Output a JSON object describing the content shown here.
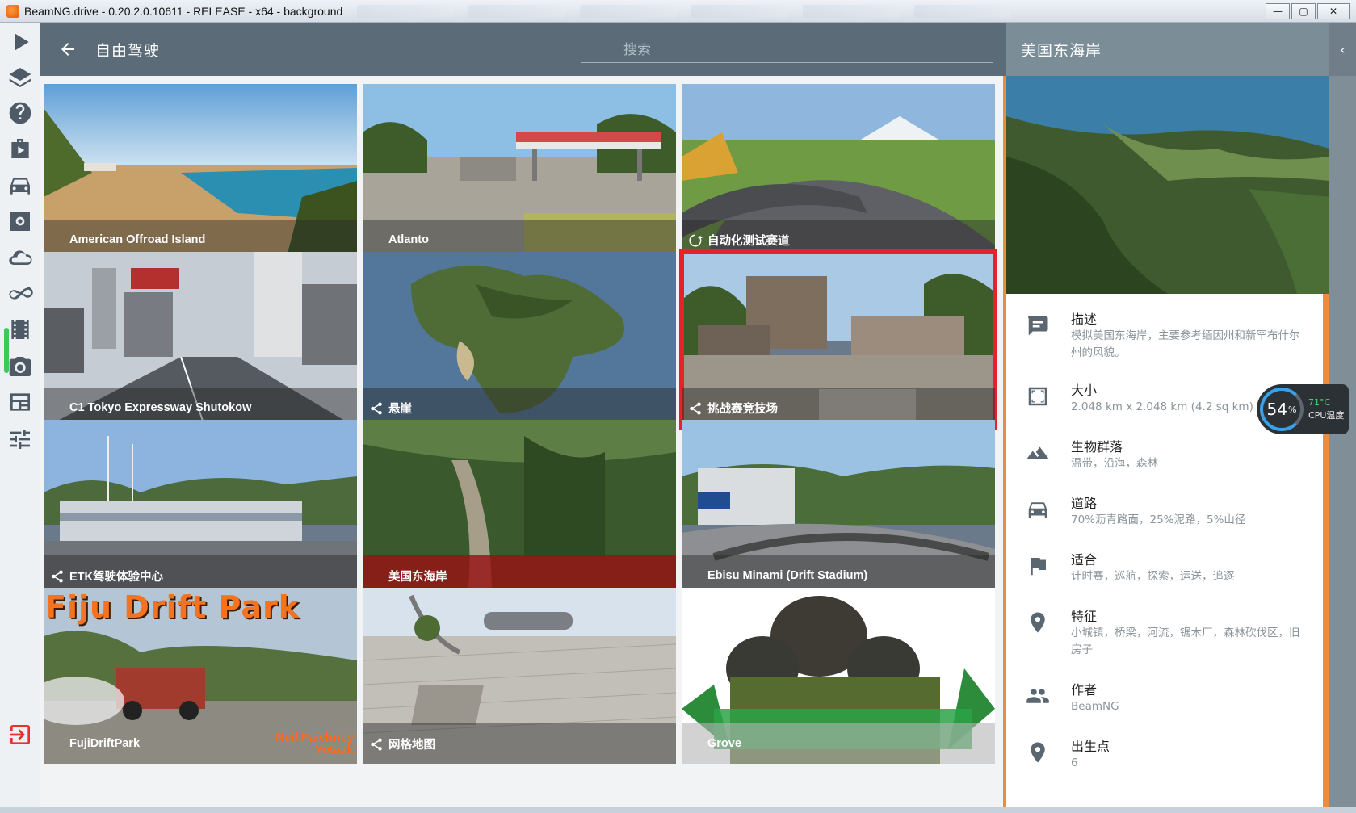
{
  "window": {
    "title": "BeamNG.drive - 0.20.2.0.10611 - RELEASE - x64 - background",
    "controls": {
      "minimize": "—",
      "maximize": "▢",
      "close": "✕"
    }
  },
  "left_rail": [
    {
      "name": "play-icon"
    },
    {
      "name": "layers-icon"
    },
    {
      "name": "help-icon"
    },
    {
      "name": "career-icon"
    },
    {
      "name": "vehicle-icon"
    },
    {
      "name": "settings-icon"
    },
    {
      "name": "cloud-icon"
    },
    {
      "name": "infinity-icon"
    },
    {
      "name": "film-icon"
    },
    {
      "name": "camera-icon"
    },
    {
      "name": "layout-icon"
    },
    {
      "name": "sliders-icon"
    },
    {
      "name": "exit-icon"
    }
  ],
  "header": {
    "title": "自由驾驶",
    "search_placeholder": "搜索"
  },
  "maps": [
    {
      "label": "American Offroad Island",
      "icon": "",
      "style": "normal"
    },
    {
      "label": "Atlanto",
      "icon": "",
      "style": "normal"
    },
    {
      "label": "自动化测试赛道",
      "icon": "spin-icon",
      "style": "normal"
    },
    {
      "label": "C1 Tokyo Expressway Shutokow",
      "icon": "",
      "style": "normal"
    },
    {
      "label": "悬崖",
      "icon": "share-icon",
      "style": "normal"
    },
    {
      "label": "挑战赛竞技场",
      "icon": "share-icon",
      "style": "selected"
    },
    {
      "label": "ETK驾驶体验中心",
      "icon": "share-icon",
      "style": "normal"
    },
    {
      "label": "美国东海岸",
      "icon": "",
      "style": "red"
    },
    {
      "label": "Ebisu Minami (Drift Stadium)",
      "icon": "",
      "style": "normal"
    },
    {
      "label": "FujiDriftPark",
      "icon": "",
      "style": "normal"
    },
    {
      "label": "网格地图",
      "icon": "share-icon",
      "style": "normal"
    },
    {
      "label": "Grove",
      "icon": "",
      "style": "light"
    }
  ],
  "fiju": {
    "title": "Fiju Drift Park",
    "author_line1": "Neil Faichney",
    "author_line2": "Yotaak"
  },
  "side_panel": {
    "title": "美国东海岸",
    "items": [
      {
        "icon": "comment-icon",
        "title": "描述",
        "text": "模拟美国东海岸，主要参考缅因州和新罕布什尔州的风貌。"
      },
      {
        "icon": "size-icon",
        "title": "大小",
        "text": "2.048 km x 2.048 km (4.2 sq km)"
      },
      {
        "icon": "terrain-icon",
        "title": "生物群落",
        "text": "温带，沿海，森林"
      },
      {
        "icon": "car-icon",
        "title": "道路",
        "text": "70%沥青路面，25%泥路，5%山径"
      },
      {
        "icon": "flag-icon",
        "title": "适合",
        "text": "计时赛，巡航，探索，运送，追逐"
      },
      {
        "icon": "pin-icon",
        "title": "特征",
        "text": "小城镇，桥梁，河流，锯木厂，森林砍伐区，旧房子"
      },
      {
        "icon": "people-icon",
        "title": "作者",
        "text": "BeamNG"
      },
      {
        "icon": "pin-icon",
        "title": "出生点",
        "text": "6"
      }
    ]
  },
  "cpu_widget": {
    "percent": "54",
    "percent_unit": "%",
    "temp": "71°C",
    "label": "CPU温度"
  },
  "colors": {
    "header": "#5b6c78",
    "accent": "#ef8c3c",
    "selected": "#e52229",
    "active_caption": "#961212"
  }
}
